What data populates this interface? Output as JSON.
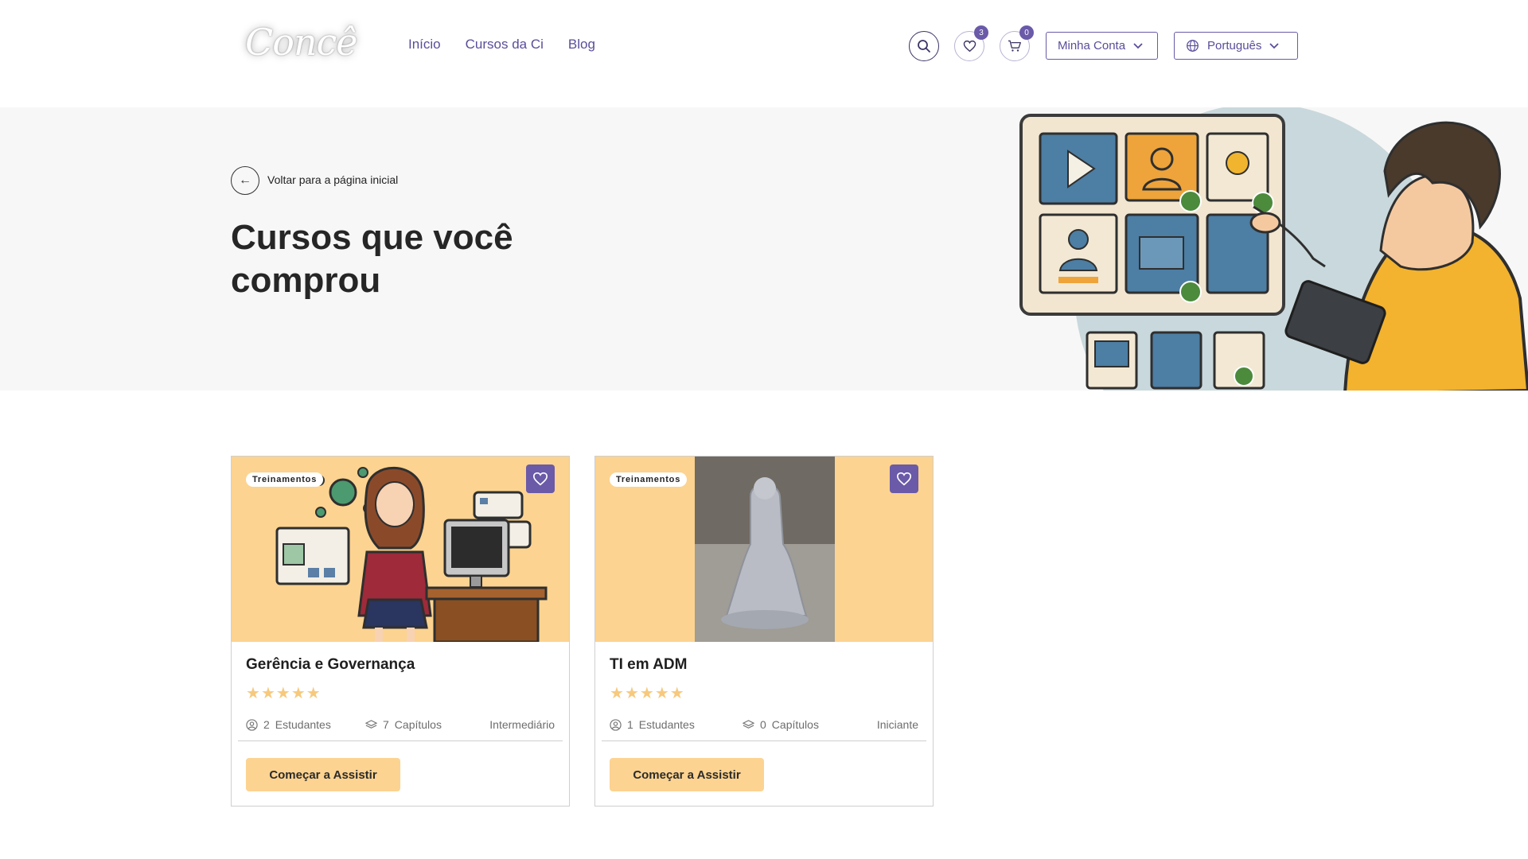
{
  "header": {
    "logo_text": "Concê",
    "nav": [
      {
        "label": "Início"
      },
      {
        "label": "Cursos da Ci"
      },
      {
        "label": "Blog"
      }
    ],
    "wishlist_count": "3",
    "cart_count": "0",
    "account_label": "Minha Conta",
    "language_label": "Português"
  },
  "hero": {
    "back_label": "Voltar para a página inicial",
    "title": "Cursos que você comprou"
  },
  "courses": [
    {
      "tag": "Treinamentos",
      "title": "Gerência e Governança",
      "rating": 5,
      "students": "2",
      "students_label": "Estudantes",
      "chapters": "7",
      "chapters_label": "Capítulos",
      "level": "Intermediário",
      "cta": "Começar a Assistir"
    },
    {
      "tag": "Treinamentos",
      "title": "TI em ADM",
      "rating": 5,
      "students": "1",
      "students_label": "Estudantes",
      "chapters": "0",
      "chapters_label": "Capítulos",
      "level": "Iniciante",
      "cta": "Começar a Assistir"
    }
  ],
  "colors": {
    "accent": "#6a5aa8",
    "card_bg": "#fcd390",
    "star": "#f7c97d",
    "hero_bg": "#f7f7f7"
  }
}
